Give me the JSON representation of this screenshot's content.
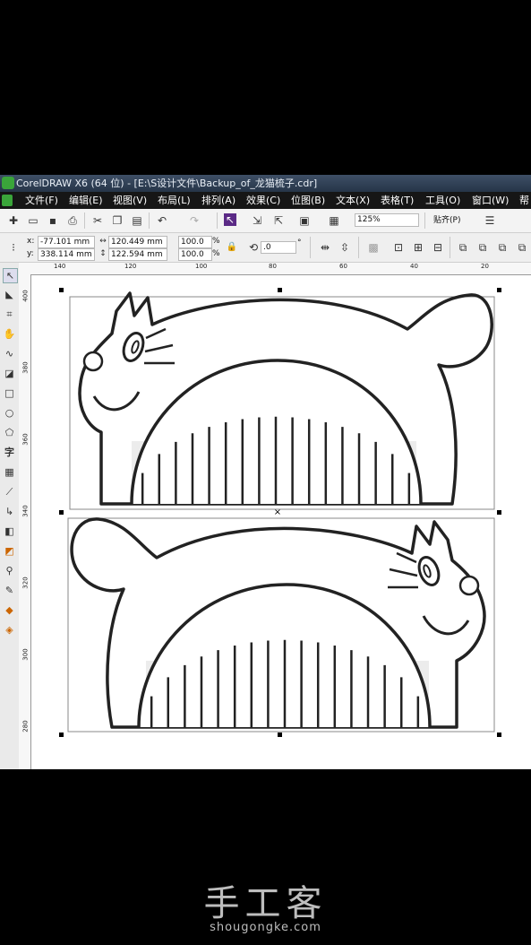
{
  "window": {
    "title": "CorelDRAW X6 (64 位) - [E:\\S设计文件\\Backup_of_龙猫梳子.cdr]"
  },
  "menu": [
    "文件(F)",
    "编辑(E)",
    "视图(V)",
    "布局(L)",
    "排列(A)",
    "效果(C)",
    "位图(B)",
    "文本(X)",
    "表格(T)",
    "工具(O)",
    "窗口(W)",
    "帮"
  ],
  "toolbar": {
    "zoom": "125%",
    "snap": "贴齐(P)"
  },
  "props": {
    "x_label": "x:",
    "x_value": "-77.101 mm",
    "y_label": "y:",
    "y_value": "338.114 mm",
    "w_value": "120.449 mm",
    "h_value": "122.594 mm",
    "scale_x": "100.0",
    "scale_y": "100.0",
    "pct": "%",
    "rotate": ".0",
    "deg": "°"
  },
  "ruler": {
    "top": [
      "140",
      "120",
      "100",
      "80",
      "60",
      "40",
      "20"
    ],
    "left": [
      "400",
      "380",
      "360",
      "340",
      "320",
      "300",
      "280"
    ]
  },
  "tools": [
    "select",
    "shape",
    "crop",
    "zoom",
    "freehand",
    "smart-fill",
    "rectangle",
    "ellipse",
    "polygon",
    "text",
    "table",
    "dimension",
    "connector",
    "blend",
    "eyedropper",
    "outline",
    "fill",
    "interactive-fill"
  ],
  "colors": {
    "titlebar": "#2f3e53",
    "menubar": "#161616",
    "accent": "#3aa53a",
    "comb_fill": "#ececec"
  },
  "watermark": {
    "logo": "手工客",
    "url": "shougongke.com"
  }
}
